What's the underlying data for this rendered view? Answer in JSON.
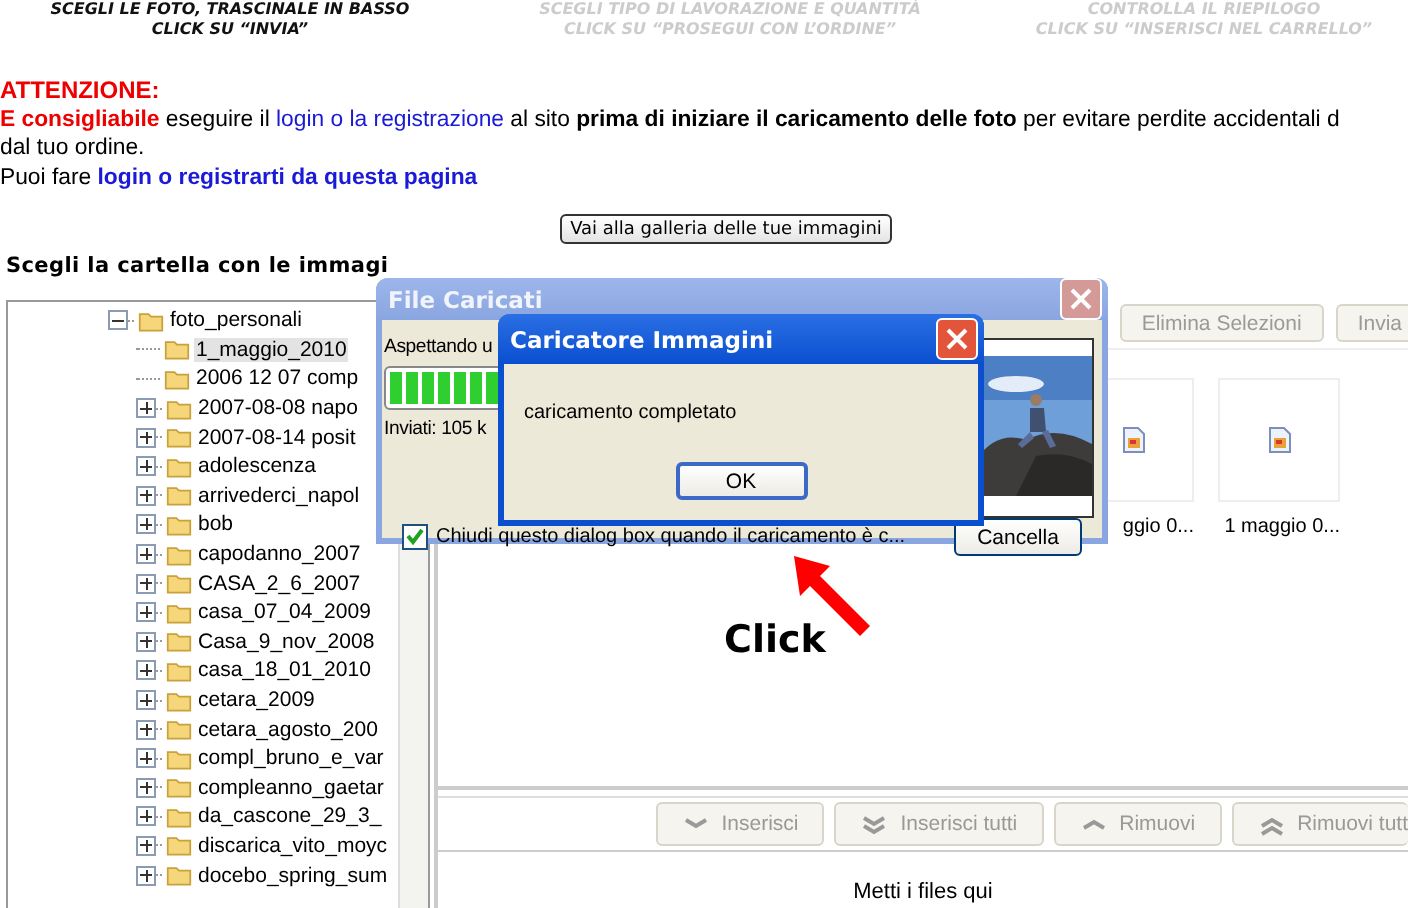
{
  "steps": [
    {
      "lines": [
        "SCEGLI LE FOTO, TRASCINALE IN BASSO",
        "CLICK SU “INVIA”"
      ],
      "active": true
    },
    {
      "lines": [
        "SCEGLI TIPO DI LAVORAZIONE E QUANTITÀ",
        "CLICK SU “PROSEGUI CON L’ORDINE”"
      ],
      "active": false
    },
    {
      "lines": [
        "CONTROLLA IL RIEPILOGO",
        "CLICK SU “INSERISCI NEL CARRELLO”"
      ],
      "active": false
    }
  ],
  "notice": {
    "heading": "ATTENZIONE:",
    "lines": [
      [
        {
          "kind": "warn",
          "text": "E consigliabile"
        },
        {
          "kind": "plain",
          "text": " eseguire il "
        },
        {
          "kind": "link",
          "text": "login o la registrazione"
        },
        {
          "kind": "plain",
          "text": " al sito "
        },
        {
          "kind": "bold",
          "text": "prima di iniziare il caricamento delle foto"
        },
        {
          "kind": "plain",
          "text": " per evitare perdite accidentali d"
        }
      ],
      [
        {
          "kind": "plain",
          "text": "dal tuo ordine."
        }
      ],
      [
        {
          "kind": "plain",
          "text": "Puoi fare "
        },
        {
          "kind": "boldlink",
          "text": "login o registrarti da questa pagina"
        }
      ]
    ]
  },
  "gallery_button": "Vai alla galleria delle tue immagini",
  "folder_label": "Scegli la cartella con le immagi",
  "tree": [
    {
      "label": "foto_personali",
      "kind": "expanded",
      "selected": false,
      "children": [
        {
          "label": "1_maggio_2010",
          "kind": "leaf",
          "selected": true
        },
        {
          "label": "2006 12 07  comp",
          "kind": "leaf",
          "selected": false
        },
        {
          "label": "2007-08-08 napo",
          "kind": "collapsed",
          "selected": false
        },
        {
          "label": "2007-08-14 posit",
          "kind": "collapsed",
          "selected": false
        },
        {
          "label": "adolescenza",
          "kind": "collapsed",
          "selected": false
        },
        {
          "label": "arrivederci_napol",
          "kind": "collapsed",
          "selected": false
        },
        {
          "label": "bob",
          "kind": "collapsed",
          "selected": false
        },
        {
          "label": "capodanno_2007",
          "kind": "collapsed",
          "selected": false
        },
        {
          "label": "CASA_2_6_2007",
          "kind": "collapsed",
          "selected": false
        },
        {
          "label": "casa_07_04_2009",
          "kind": "collapsed",
          "selected": false
        },
        {
          "label": "Casa_9_nov_2008",
          "kind": "collapsed",
          "selected": false
        },
        {
          "label": "casa_18_01_2010",
          "kind": "collapsed",
          "selected": false
        },
        {
          "label": "cetara_2009",
          "kind": "collapsed",
          "selected": false
        },
        {
          "label": "cetara_agosto_200",
          "kind": "collapsed",
          "selected": false
        },
        {
          "label": "compl_bruno_e_var",
          "kind": "collapsed",
          "selected": false
        },
        {
          "label": "compleanno_gaetar",
          "kind": "collapsed",
          "selected": false
        },
        {
          "label": "da_cascone_29_3_",
          "kind": "collapsed",
          "selected": false
        },
        {
          "label": "discarica_vito_moyc",
          "kind": "collapsed",
          "selected": false
        },
        {
          "label": "docebo_spring_sum",
          "kind": "collapsed",
          "selected": false
        }
      ]
    }
  ],
  "toolbar": [
    {
      "label": "Elimina Selezioni",
      "disabled": true
    },
    {
      "label": "Invia",
      "disabled": true
    }
  ],
  "thumbnails": [
    {
      "caption": "ggio 0..."
    },
    {
      "caption": "1 maggio 0..."
    }
  ],
  "transfer_buttons": [
    {
      "label": "Inserisci",
      "kind": "down"
    },
    {
      "label": "Inserisci tutti",
      "kind": "double-down"
    },
    {
      "label": "Rimuovi",
      "kind": "up"
    },
    {
      "label": "Rimuovi tutt",
      "kind": "double-up"
    }
  ],
  "drop_hint": "Metti i files qui",
  "upload_dialog": {
    "title": "File Caricati",
    "status": "Aspettando u",
    "progress": {
      "level": 0.5
    },
    "sent": "Inviati: 105 k",
    "close_checkbox": {
      "label": "Chiudi questo dialog box quando il caricamento è c...",
      "checked": true
    },
    "cancel": "Cancella"
  },
  "message_dialog": {
    "title": "Caricatore Immagini",
    "message": "caricamento completato",
    "ok": "OK"
  },
  "annotation": "Click"
}
